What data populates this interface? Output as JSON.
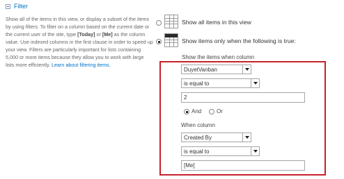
{
  "section": {
    "title": "Filter",
    "description": {
      "part1": "Show all of the items in this view, or display a subset of the items by using filters. To filter on a column based on the current date or the current user of the site, type ",
      "today": "[Today]",
      "or": " or ",
      "me": "[Me]",
      "part2": " as the column value. Use indexed columns in the first clause in order to speed up your view. Filters are particularly important for lists containing 5,000 or more items because they allow you to work with large lists more efficiently. ",
      "link": "Learn about filtering items."
    }
  },
  "options": {
    "show_all": {
      "label": "Show all items in this view",
      "selected": false
    },
    "show_filtered": {
      "label": "Show items only when the following is true:",
      "selected": true
    }
  },
  "filter": {
    "show_when_label": "Show the items when column",
    "first_clause": {
      "column": "DuyetVanban",
      "operator": "is equal to",
      "value": "2"
    },
    "logic": {
      "and_label": "And",
      "or_label": "Or",
      "selected": "And"
    },
    "when_column_label": "When column",
    "second_clause": {
      "column": "Created By",
      "operator": "is equal to",
      "value": "[Me]"
    }
  }
}
